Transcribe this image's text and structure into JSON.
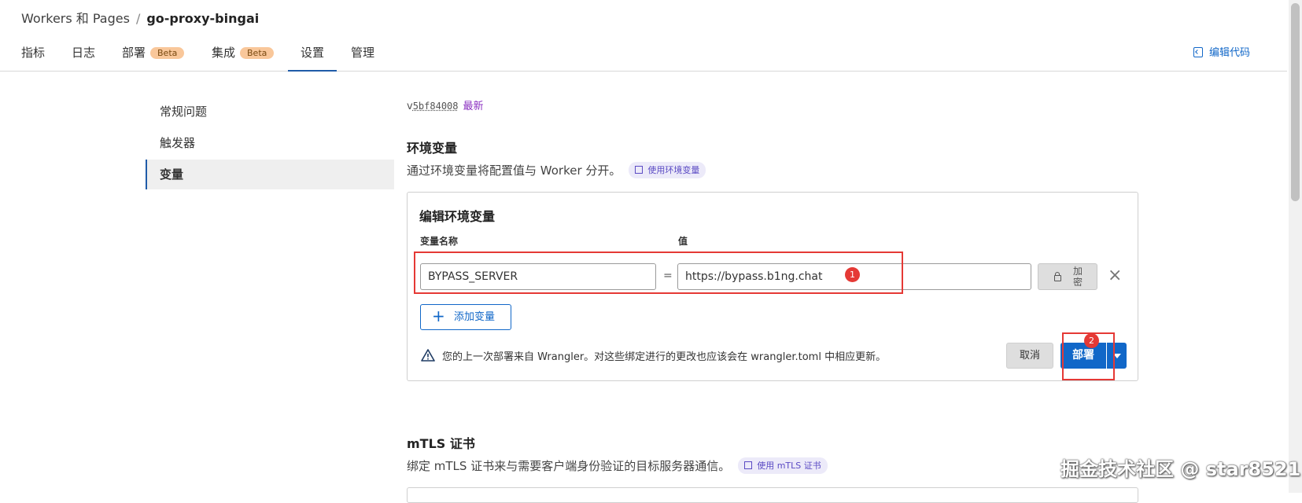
{
  "breadcrumb": {
    "parent": "Workers 和 Pages",
    "separator": "/",
    "current": "go-proxy-bingai"
  },
  "tabs": [
    {
      "label": "指标"
    },
    {
      "label": "日志"
    },
    {
      "label": "部署",
      "badge": "Beta"
    },
    {
      "label": "集成",
      "badge": "Beta"
    },
    {
      "label": "设置",
      "active": true
    },
    {
      "label": "管理"
    }
  ],
  "header": {
    "edit_code_label": "编辑代码",
    "edit_code_icon": "code-icon"
  },
  "sidebar": {
    "items": [
      {
        "label": "常规问题"
      },
      {
        "label": "触发器"
      },
      {
        "label": "变量",
        "active": true
      }
    ]
  },
  "version": {
    "prefix": "v",
    "hash": "5bf84008",
    "latest": "最新"
  },
  "env": {
    "title": "环境变量",
    "description": "通过环境变量将配置值与 Worker 分开。",
    "doc_link": "使用环境变量",
    "card_title": "编辑环境变量",
    "col_name": "变量名称",
    "col_value": "值",
    "var_name": "BYPASS_SERVER",
    "equals": "=",
    "var_value": "https://bypass.b1ng.chat",
    "encrypt_label": "加密",
    "remove_icon": "close-icon",
    "add_var_label": "添加变量",
    "warning_icon": "warning-icon",
    "warning_text": "您的上一次部署来自 Wrangler。对这些绑定进行的更改也应该会在 wrangler.toml 中相应更新。",
    "cancel_label": "取消",
    "deploy_label": "部署"
  },
  "annotations": {
    "mark1": "1",
    "mark2": "2",
    "color": "#e53935"
  },
  "mtls": {
    "title": "mTLS 证书",
    "description": "绑定 mTLS 证书来与需要客户端身份验证的目标服务器通信。",
    "doc_link": "使用 mTLS 证书"
  },
  "watermark": "掘金技术社区 @ star8521",
  "colors": {
    "accent": "#1167c8",
    "badge": "#f9c79a",
    "link_purple": "#5b4bc4",
    "annotation": "#e53935"
  }
}
